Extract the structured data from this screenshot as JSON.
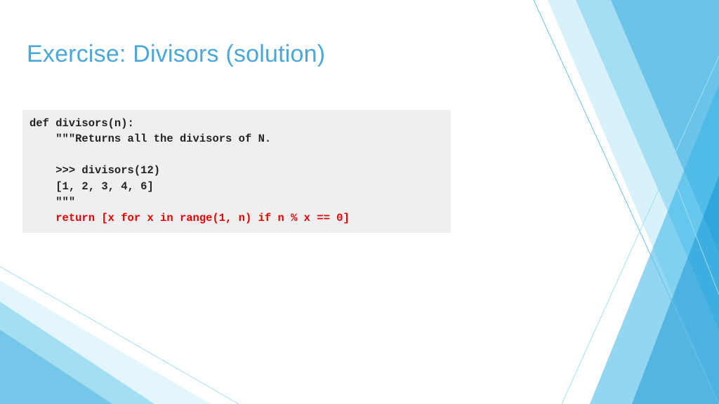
{
  "title": "Exercise: Divisors (solution)",
  "code": {
    "l1": "def divisors(n):",
    "l2": "\"\"\"Returns all the divisors of N.",
    "l3": ">>> divisors(12)",
    "l4": "[1, 2, 3, 4, 6]",
    "l5": "\"\"\"",
    "l6": "return [x for x in range(1, n) if n % x == 0]"
  }
}
